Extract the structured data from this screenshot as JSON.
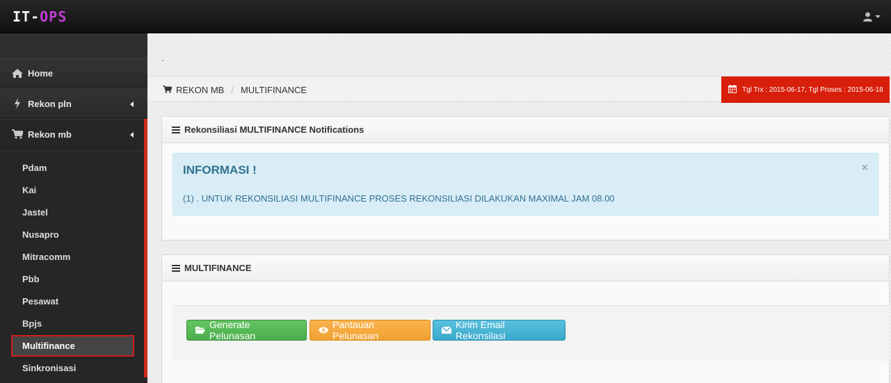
{
  "brand": {
    "part1": "IT-",
    "part2": "OPS"
  },
  "user_menu": {
    "icon": "user-icon"
  },
  "sidebar": {
    "items": [
      {
        "label": "Home",
        "icon": "home-icon"
      },
      {
        "label": "Rekon pln",
        "icon": "bolt-icon"
      },
      {
        "label": "Rekon mb",
        "icon": "cart-icon"
      }
    ],
    "sub_items": [
      "Pdam",
      "Kai",
      "Jastel",
      "Nusapro",
      "Mitracomm",
      "Pbb",
      "Pesawat",
      "Bpjs",
      "Multifinance",
      "Sinkronisasi"
    ],
    "selected": "Multifinance"
  },
  "main": {
    "dot": ".",
    "breadcrumb": {
      "first": "REKON MB",
      "separator": "/",
      "second": "MULTIFINANCE"
    },
    "date_badge": "Tgl Trx : 2015-06-17, Tgl Proses : 2015-06-18",
    "notifications_panel": {
      "title": "Rekonsiliasi MULTIFINANCE Notifications",
      "alert_title": "INFORMASI !",
      "alert_text": "(1) . UNTUK REKONSILIASI MULTIFINANCE PROSES REKONSILIASI DILAKUKAN MAXIMAL JAM 08.00",
      "close": "×"
    },
    "multifinance_panel": {
      "title": "MULTIFINANCE",
      "buttons": {
        "generate": "Generate Pelunasan",
        "pantauan": "Pantauan Pelunasan",
        "email": "Kirim Email Rekonsilasi"
      }
    }
  },
  "colors": {
    "accent_red": "#d81f0b",
    "info_bg": "#d9edf7",
    "info_text": "#31708f",
    "green": "#5cb85c",
    "orange": "#f0ad4e",
    "blue": "#5bc0de"
  }
}
